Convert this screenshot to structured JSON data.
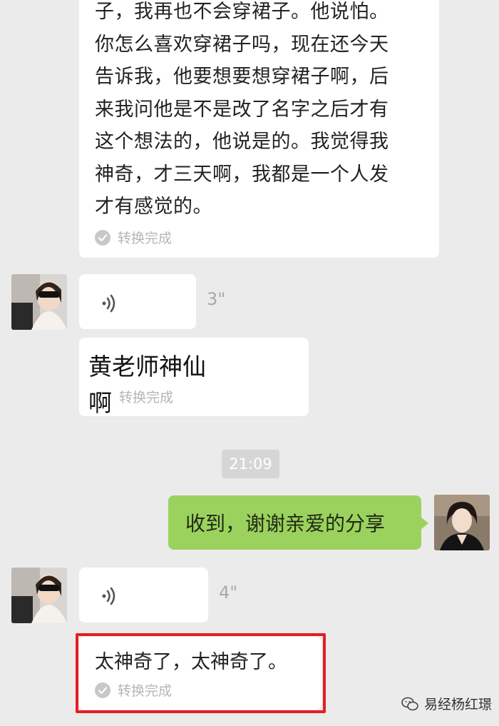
{
  "messages": {
    "long_text": "子，我再也不会穿裙子。他说怕。\n你怎么喜欢穿裙子吗，现在还今天\n告诉我，他要想要想穿裙子啊，后\n来我问他是不是改了名字之后才有\n这个想法的，他说是的。我觉得我\n神奇，才三天啊，我都是一个人发\n才有感觉的。",
    "conversion_status": "转换完成",
    "voice1_duration": "3\"",
    "handwritten_line1": "黄老师神仙",
    "handwritten_line2": "啊",
    "time_label": "21:09",
    "sent_text": "收到，谢谢亲爱的分享",
    "voice2_duration": "4\"",
    "final_text": "太神奇了，太神奇了。"
  },
  "watermark": {
    "text": "易经杨红璟"
  },
  "colors": {
    "background": "#ebebeb",
    "sent_bubble": "#9bd25e",
    "highlight": "#e31e24"
  }
}
